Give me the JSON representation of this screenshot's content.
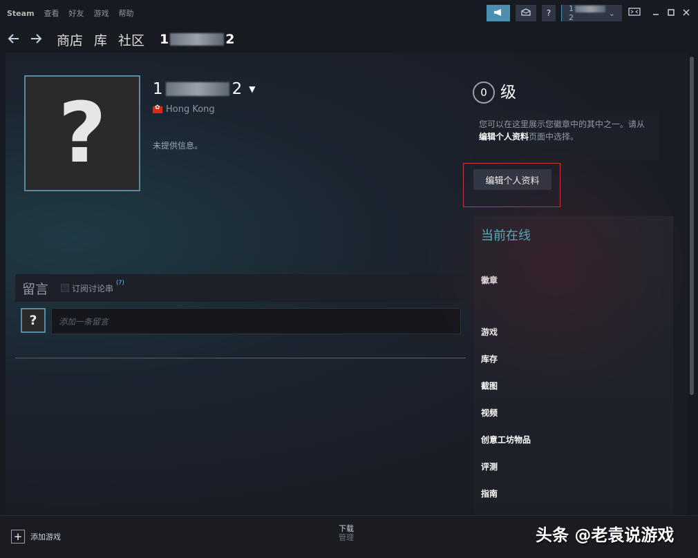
{
  "menu": {
    "brand": "Steam",
    "items": [
      "查看",
      "好友",
      "游戏",
      "帮助"
    ]
  },
  "topright": {
    "help": "?",
    "account_prefix": "1",
    "account_suffix": "2",
    "caret": "⌄"
  },
  "nav": {
    "store": "商店",
    "library": "库",
    "community": "社区",
    "user_prefix": "1",
    "user_suffix": "2"
  },
  "profile": {
    "avatar_glyph": "?",
    "name_prefix": "1",
    "name_suffix": "2",
    "location": "Hong Kong",
    "no_info": "未提供信息。"
  },
  "level": {
    "value": "0",
    "label": "级",
    "hint_part1": "您可以在这里展示您徽章中的其中之一。请从",
    "hint_bold": "编辑个人资料",
    "hint_part2": "页面中选择。",
    "edit_button": "编辑个人资料"
  },
  "online_panel": {
    "title": "当前在线",
    "links": [
      "徽章",
      "游戏",
      "库存",
      "截图",
      "视频",
      "创意工坊物品",
      "评测",
      "指南"
    ]
  },
  "comments": {
    "title": "留言",
    "subscribe": "订阅讨论串",
    "help": "(?)",
    "avatar_glyph": "?",
    "placeholder": "添加一条留言"
  },
  "bottom": {
    "add_game": "添加游戏",
    "downloads": "下载",
    "manage": "管理",
    "watermark": "头条 @老袁说游戏"
  },
  "colors": {
    "accent": "#57cbde",
    "highlight_border": "#d8323c",
    "announce_button": "#4c8fb1"
  }
}
